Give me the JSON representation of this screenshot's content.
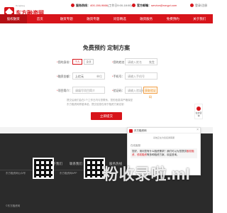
{
  "brand": {
    "small_text": "Dongfang",
    "name": "东方融资网"
  },
  "header": {
    "hotline_label": "服务热线：",
    "hotline_value": "400-156-9666",
    "hotline_hours": "(工作日9:00-18:00)",
    "email_label": "官方邮箱：",
    "email_value": "service@rongzi.com",
    "login_label": "登录/注册"
  },
  "nav": {
    "items": [
      {
        "label": "股权融资"
      },
      {
        "label": "首页"
      },
      {
        "label": "融资专题"
      },
      {
        "label": "融资专题"
      },
      {
        "label": "问答精选"
      },
      {
        "label": "融资服务"
      },
      {
        "label": "免费预约"
      },
      {
        "label": "关于我们"
      }
    ]
  },
  "form": {
    "title": "免费预约 定制方案",
    "type_label": "您的身份：",
    "type_options": [
      "个人",
      "企业"
    ],
    "name_label": "您的姓名：",
    "name_placeholder": "请输入姓名",
    "gender_label": "先生",
    "amount_label": "融资金额：",
    "amount_value": "上亿元",
    "unit_label": "单位",
    "phone_label": "手机号：",
    "phone_placeholder": "请输入手机号",
    "code_label": "验证码：",
    "code_placeholder": "请输入验证码",
    "code_button": "获取验证码",
    "intro_label": "项目简介：",
    "intro_placeholder": "请填写项目简介",
    "note_line1": "提交后我们会在1个工作日内与您联系，您的信息将严格保密",
    "note_line2": "东方融资网郑重承诺，提交信息仅用于融资方案定制",
    "submit_label": "立即提交"
  },
  "footer": {
    "nav": [
      "关于我们",
      "联系我们",
      "加入我们",
      "服务热线"
    ],
    "wechat_label": "东方融资网公众号",
    "app_label": "东方融资网APP",
    "copyright": "©东方融资网"
  },
  "chat": {
    "title": "东方融资网",
    "close_icon": "close-icon",
    "subtitle": "系统正在为您接通客服",
    "sender": "在线客服",
    "message_part1": "您好，请问您有什么融资需求？我们可以为您提供",
    "message_highlight": "股权融资、债权融资",
    "message_part2": "等多种融资方案，欢迎咨询。"
  },
  "side_widget": {
    "label": "在线咨询"
  },
  "watermark": "粉收录啦.ml",
  "colors": {
    "brand_red": "#d7141a",
    "footer_bg": "#2b2b2b",
    "nav_active": "#b40f14"
  }
}
